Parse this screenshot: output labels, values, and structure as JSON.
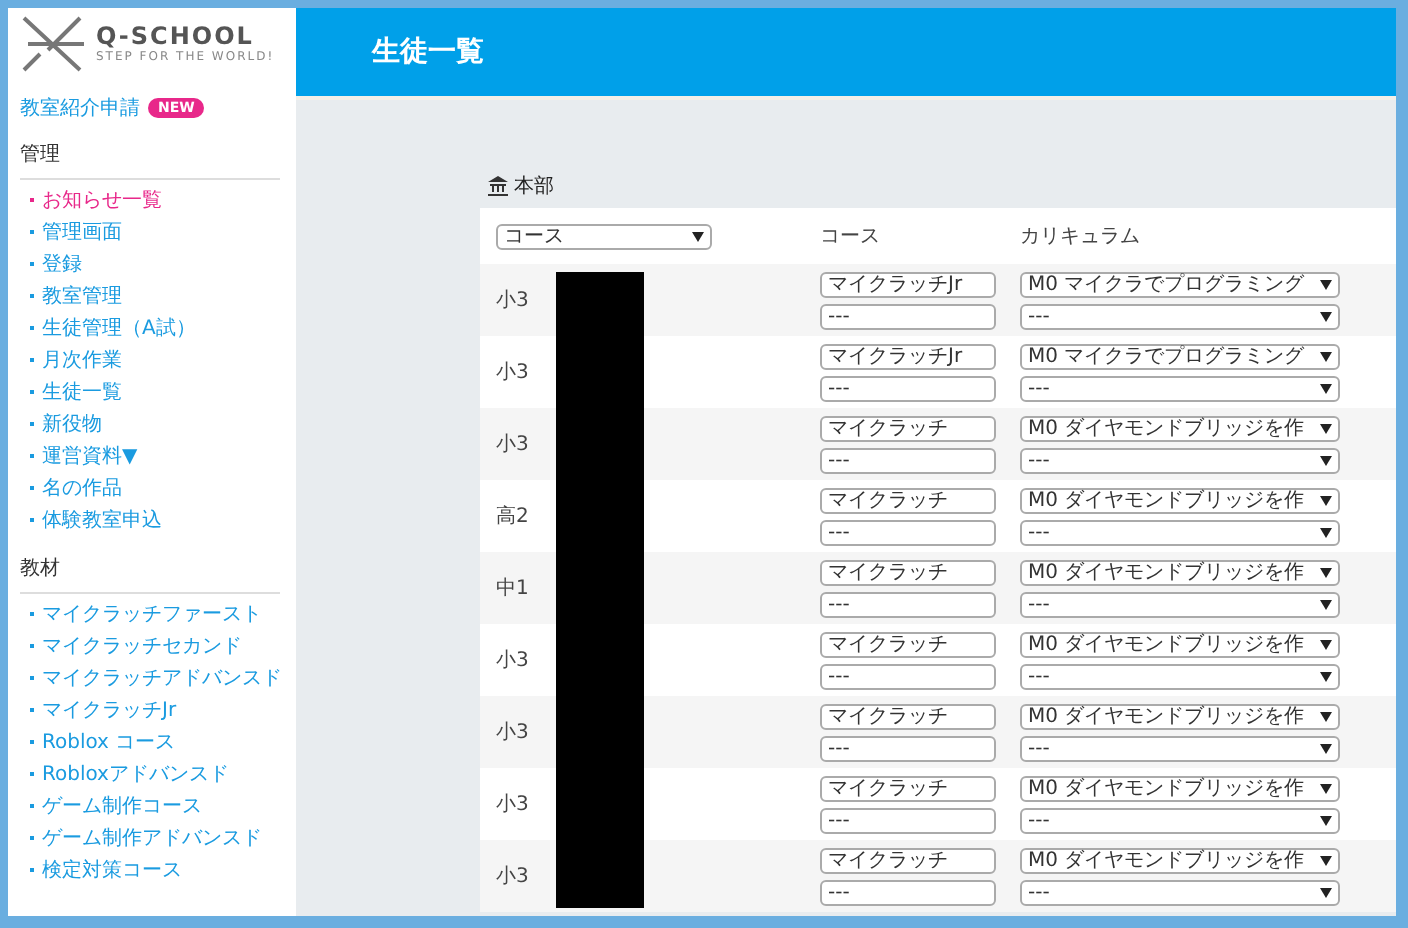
{
  "logo": {
    "name": "Q-SCHOOL",
    "subtitle": "STEP FOR THE WORLD!"
  },
  "sidebar": {
    "top_link": {
      "label": "教室紹介申請",
      "badge": "NEW"
    },
    "sections": [
      {
        "title": "管理",
        "items": [
          {
            "label": "お知らせ一覧",
            "selected": true
          },
          {
            "label": "管理画面",
            "selected": false
          },
          {
            "label": "登録",
            "selected": false
          },
          {
            "label": "教室管理",
            "selected": false
          },
          {
            "label": "生徒管理（A試）",
            "selected": false
          },
          {
            "label": "月次作業",
            "selected": false
          },
          {
            "label": "生徒一覧",
            "selected": false
          },
          {
            "label": "新役物",
            "selected": false
          },
          {
            "label": "運営資料▼",
            "selected": false
          },
          {
            "label": "名の作品",
            "selected": false
          },
          {
            "label": "体験教室申込",
            "selected": false
          }
        ]
      },
      {
        "title": "教材",
        "items": [
          {
            "label": "マイクラッチファースト",
            "selected": false
          },
          {
            "label": "マイクラッチセカンド",
            "selected": false
          },
          {
            "label": "マイクラッチアドバンスド",
            "selected": false
          },
          {
            "label": "マイクラッチJr",
            "selected": false
          },
          {
            "label": "Roblox コース",
            "selected": false
          },
          {
            "label": "Robloxアドバンスド",
            "selected": false
          },
          {
            "label": "ゲーム制作コース",
            "selected": false
          },
          {
            "label": "ゲーム制作アドバンスド",
            "selected": false
          },
          {
            "label": "検定対策コース",
            "selected": false
          }
        ]
      }
    ]
  },
  "header": {
    "title": "生徒一覧"
  },
  "panel": {
    "title": "本部",
    "filter": {
      "value": "コース"
    },
    "columns": [
      "コース",
      "カリキュラム"
    ],
    "rows": [
      {
        "grade": "小3",
        "course": "マイクラッチJr",
        "course_sub": "---",
        "curriculum": "M0 マイクラでプログラミング",
        "curriculum_sub": "---"
      },
      {
        "grade": "小3",
        "course": "マイクラッチJr",
        "course_sub": "---",
        "curriculum": "M0 マイクラでプログラミング",
        "curriculum_sub": "---"
      },
      {
        "grade": "小3",
        "course": "マイクラッチ",
        "course_sub": "---",
        "curriculum": "M0 ダイヤモンドブリッジを作",
        "curriculum_sub": "---"
      },
      {
        "grade": "高2",
        "course": "マイクラッチ",
        "course_sub": "---",
        "curriculum": "M0 ダイヤモンドブリッジを作",
        "curriculum_sub": "---"
      },
      {
        "grade": "中1",
        "course": "マイクラッチ",
        "course_sub": "---",
        "curriculum": "M0 ダイヤモンドブリッジを作",
        "curriculum_sub": "---"
      },
      {
        "grade": "小3",
        "course": "マイクラッチ",
        "course_sub": "---",
        "curriculum": "M0 ダイヤモンドブリッジを作",
        "curriculum_sub": "---"
      },
      {
        "grade": "小3",
        "course": "マイクラッチ",
        "course_sub": "---",
        "curriculum": "M0 ダイヤモンドブリッジを作",
        "curriculum_sub": "---"
      },
      {
        "grade": "小3",
        "course": "マイクラッチ",
        "course_sub": "---",
        "curriculum": "M0 ダイヤモンドブリッジを作",
        "curriculum_sub": "---"
      },
      {
        "grade": "小3",
        "course": "マイクラッチ",
        "course_sub": "---",
        "curriculum": "M0 ダイヤモンドブリッジを作",
        "curriculum_sub": "---"
      }
    ]
  }
}
